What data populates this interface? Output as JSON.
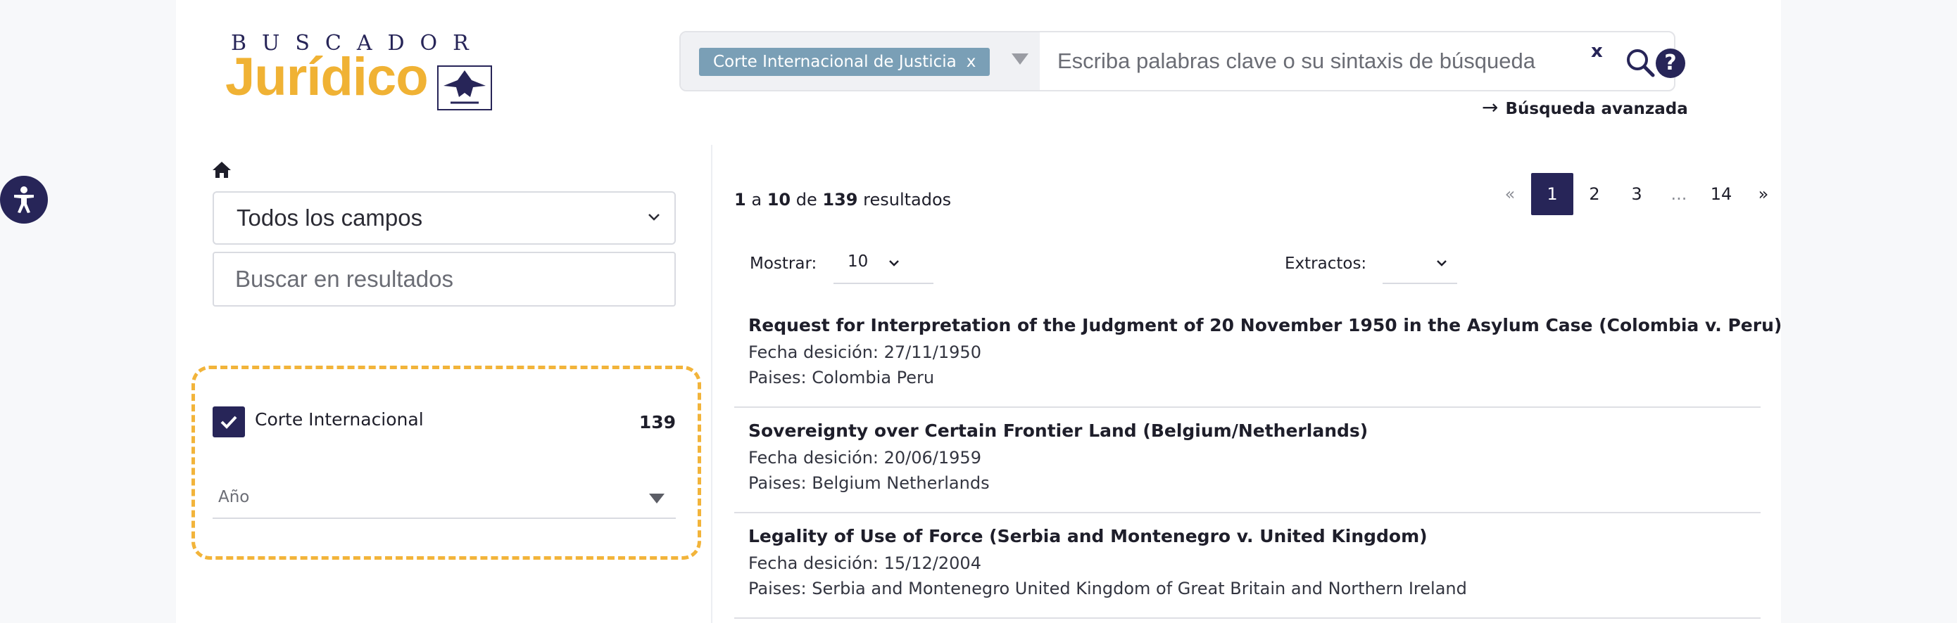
{
  "logo": {
    "top": "BUSCADOR",
    "main": "Jurídico"
  },
  "search": {
    "chip_label": "Corte Internacional de Justicia",
    "chip_remove": "x",
    "placeholder": "Escriba palabras clave o su sintaxis de búsqueda",
    "clear": "x",
    "help": "?",
    "advanced": "Búsqueda avanzada",
    "advanced_arrow": "→"
  },
  "sidebar": {
    "field_select_value": "Todos los campos",
    "refine_placeholder": "Buscar en resultados",
    "facet": {
      "label": "Corte Internacional",
      "count": "139",
      "checked": true
    },
    "year_label": "Año"
  },
  "results_header": {
    "from": "1",
    "sep1": "a",
    "to": "10",
    "sep2": "de",
    "total": "139",
    "suffix": "resultados"
  },
  "pagination": {
    "prev": "«",
    "pages": [
      "1",
      "2",
      "3",
      "...",
      "14"
    ],
    "next": "»",
    "current": "1"
  },
  "controls": {
    "show_label": "Mostrar:",
    "show_value": "10",
    "excerpt_label": "Extractos:",
    "excerpt_value": ""
  },
  "results": [
    {
      "title": "Request for Interpretation of the Judgment of 20 November 1950 in the Asylum Case (Colombia v. Peru)",
      "date": "Fecha desición: 27/11/1950",
      "countries": "Paises: Colombia Peru"
    },
    {
      "title": "Sovereignty over Certain Frontier Land (Belgium/Netherlands)",
      "date": "Fecha desición: 20/06/1959",
      "countries": "Paises: Belgium Netherlands"
    },
    {
      "title": "Legality of Use of Force (Serbia and Montenegro v. United Kingdom)",
      "date": "Fecha desición: 15/12/2004",
      "countries": "Paises: Serbia and Montenegro United Kingdom of Great Britain and Northern Ireland"
    }
  ],
  "colors": {
    "brand_navy": "#272558",
    "brand_gold": "#f0b234",
    "chip_blue": "#7a9fb6",
    "highlight_dash": "#f2b43a"
  }
}
